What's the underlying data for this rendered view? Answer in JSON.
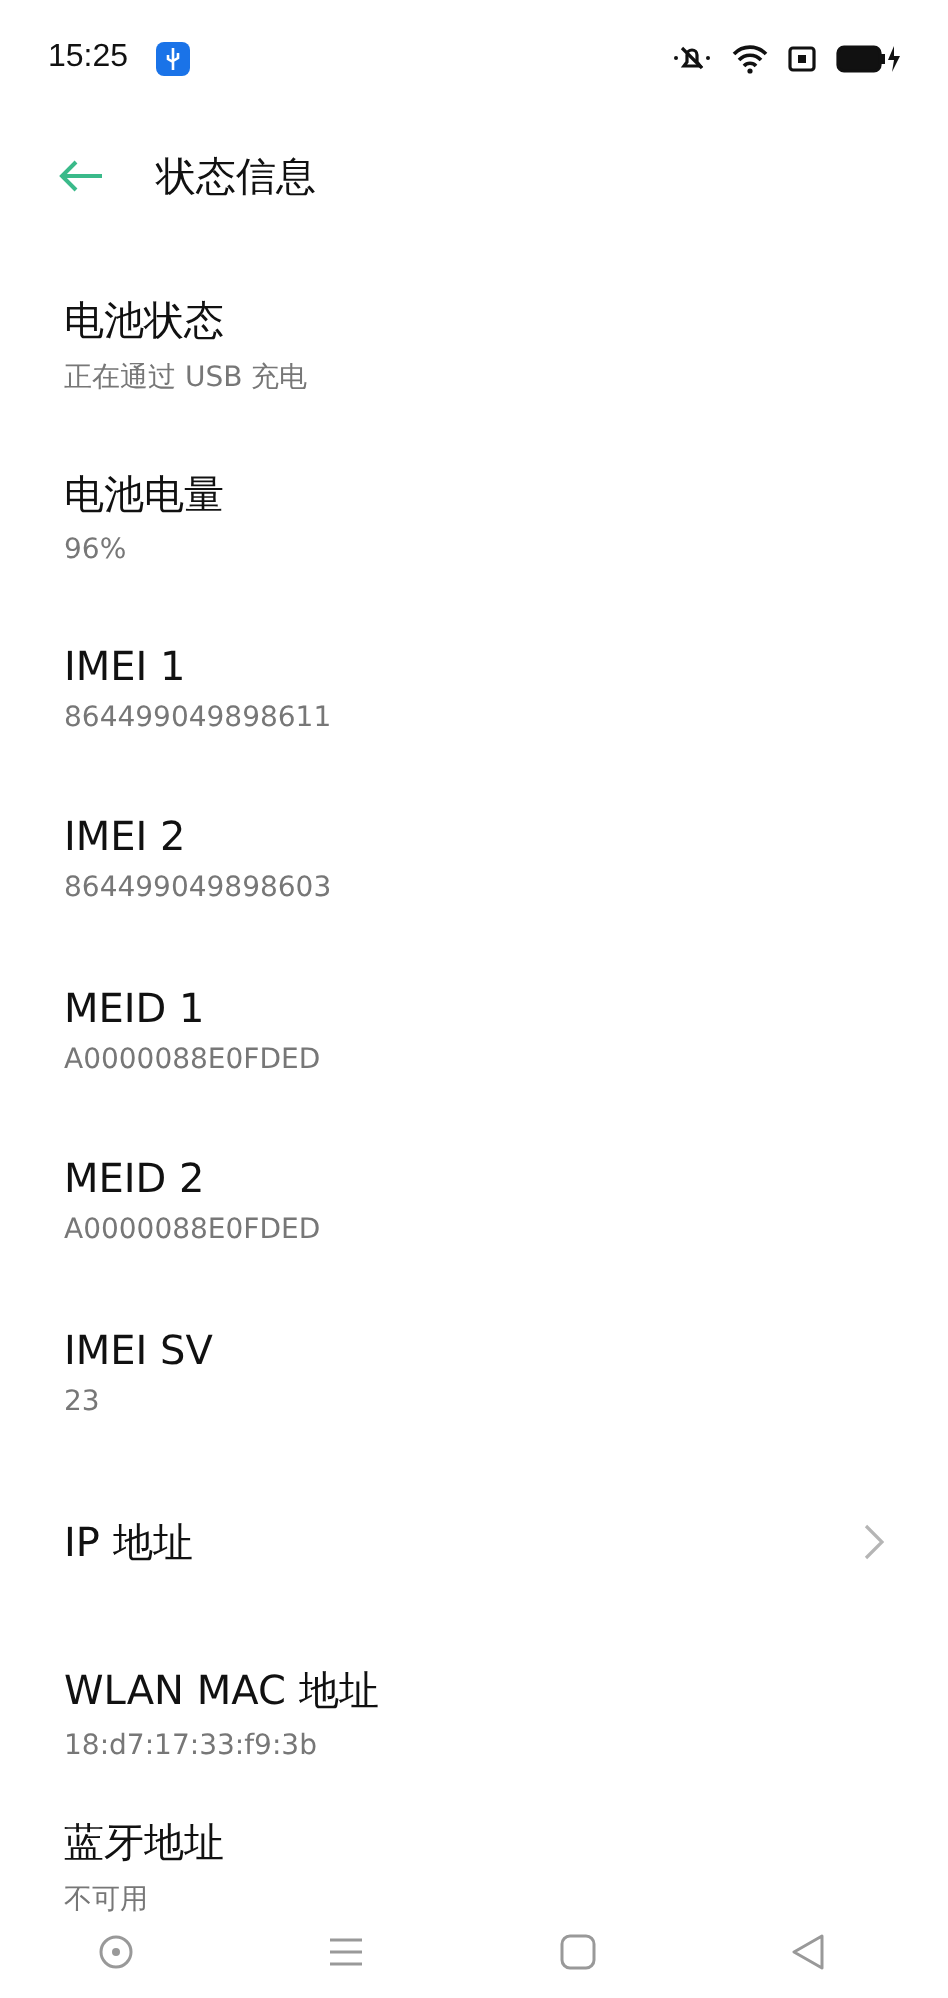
{
  "status_bar": {
    "time": "15:25"
  },
  "header": {
    "title": "状态信息"
  },
  "items": [
    {
      "kind": "info",
      "title": "电池状态",
      "subtitle": "正在通过 USB 充电"
    },
    {
      "kind": "info",
      "title": "电池电量",
      "subtitle": "96%"
    },
    {
      "kind": "info",
      "title": "IMEI 1",
      "subtitle": "864499049898611"
    },
    {
      "kind": "info",
      "title": "IMEI 2",
      "subtitle": "864499049898603"
    },
    {
      "kind": "info",
      "title": "MEID 1",
      "subtitle": "A0000088E0FDED"
    },
    {
      "kind": "info",
      "title": "MEID 2",
      "subtitle": "A0000088E0FDED"
    },
    {
      "kind": "info",
      "title": "IMEI SV",
      "subtitle": "23"
    },
    {
      "kind": "link",
      "title": "IP 地址"
    },
    {
      "kind": "info",
      "title": "WLAN MAC 地址",
      "subtitle": "18:d7:17:33:f9:3b"
    },
    {
      "kind": "info",
      "title": "蓝牙地址",
      "subtitle": "不可用"
    }
  ]
}
